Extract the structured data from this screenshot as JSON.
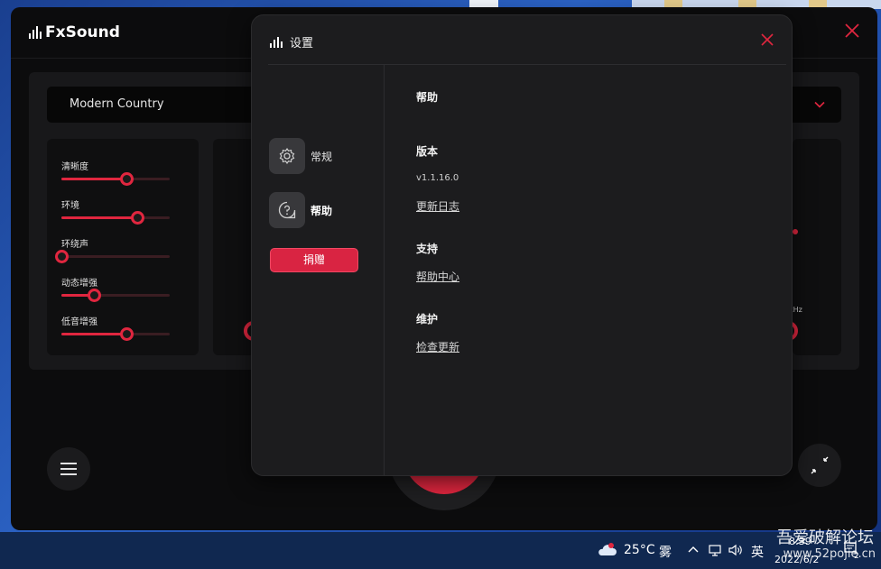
{
  "app": {
    "name": "FxSound",
    "preset": "Modern Country",
    "effects": [
      {
        "label": "清晰度",
        "value": 0.6
      },
      {
        "label": "环境",
        "value": 0.7
      },
      {
        "label": "环绕声",
        "value": 0.0
      },
      {
        "label": "动态增强",
        "value": 0.3
      },
      {
        "label": "低音增强",
        "value": 0.6
      }
    ],
    "eq_unit": "kHz",
    "accent": "#e0263f"
  },
  "settings": {
    "title": "设置",
    "nav": [
      {
        "label": "常规",
        "icon": "gear-icon"
      },
      {
        "label": "帮助",
        "icon": "help-icon"
      }
    ],
    "donate_label": "捐赠",
    "sections": {
      "help_heading": "帮助",
      "version_heading": "版本",
      "version_value": "v1.1.16.0",
      "changelog_link": "更新日志",
      "support_heading": "支持",
      "help_center_link": "帮助中心",
      "maintenance_heading": "维护",
      "check_update_link": "检查更新"
    }
  },
  "taskbar": {
    "weather": "25°C",
    "weather_desc": "雾",
    "ime": "英",
    "time": "8:39",
    "date": "2022/6/2",
    "notification_count": "2"
  },
  "watermark": {
    "title": "吾爱破解论坛",
    "url": "www.52pojie.cn"
  }
}
